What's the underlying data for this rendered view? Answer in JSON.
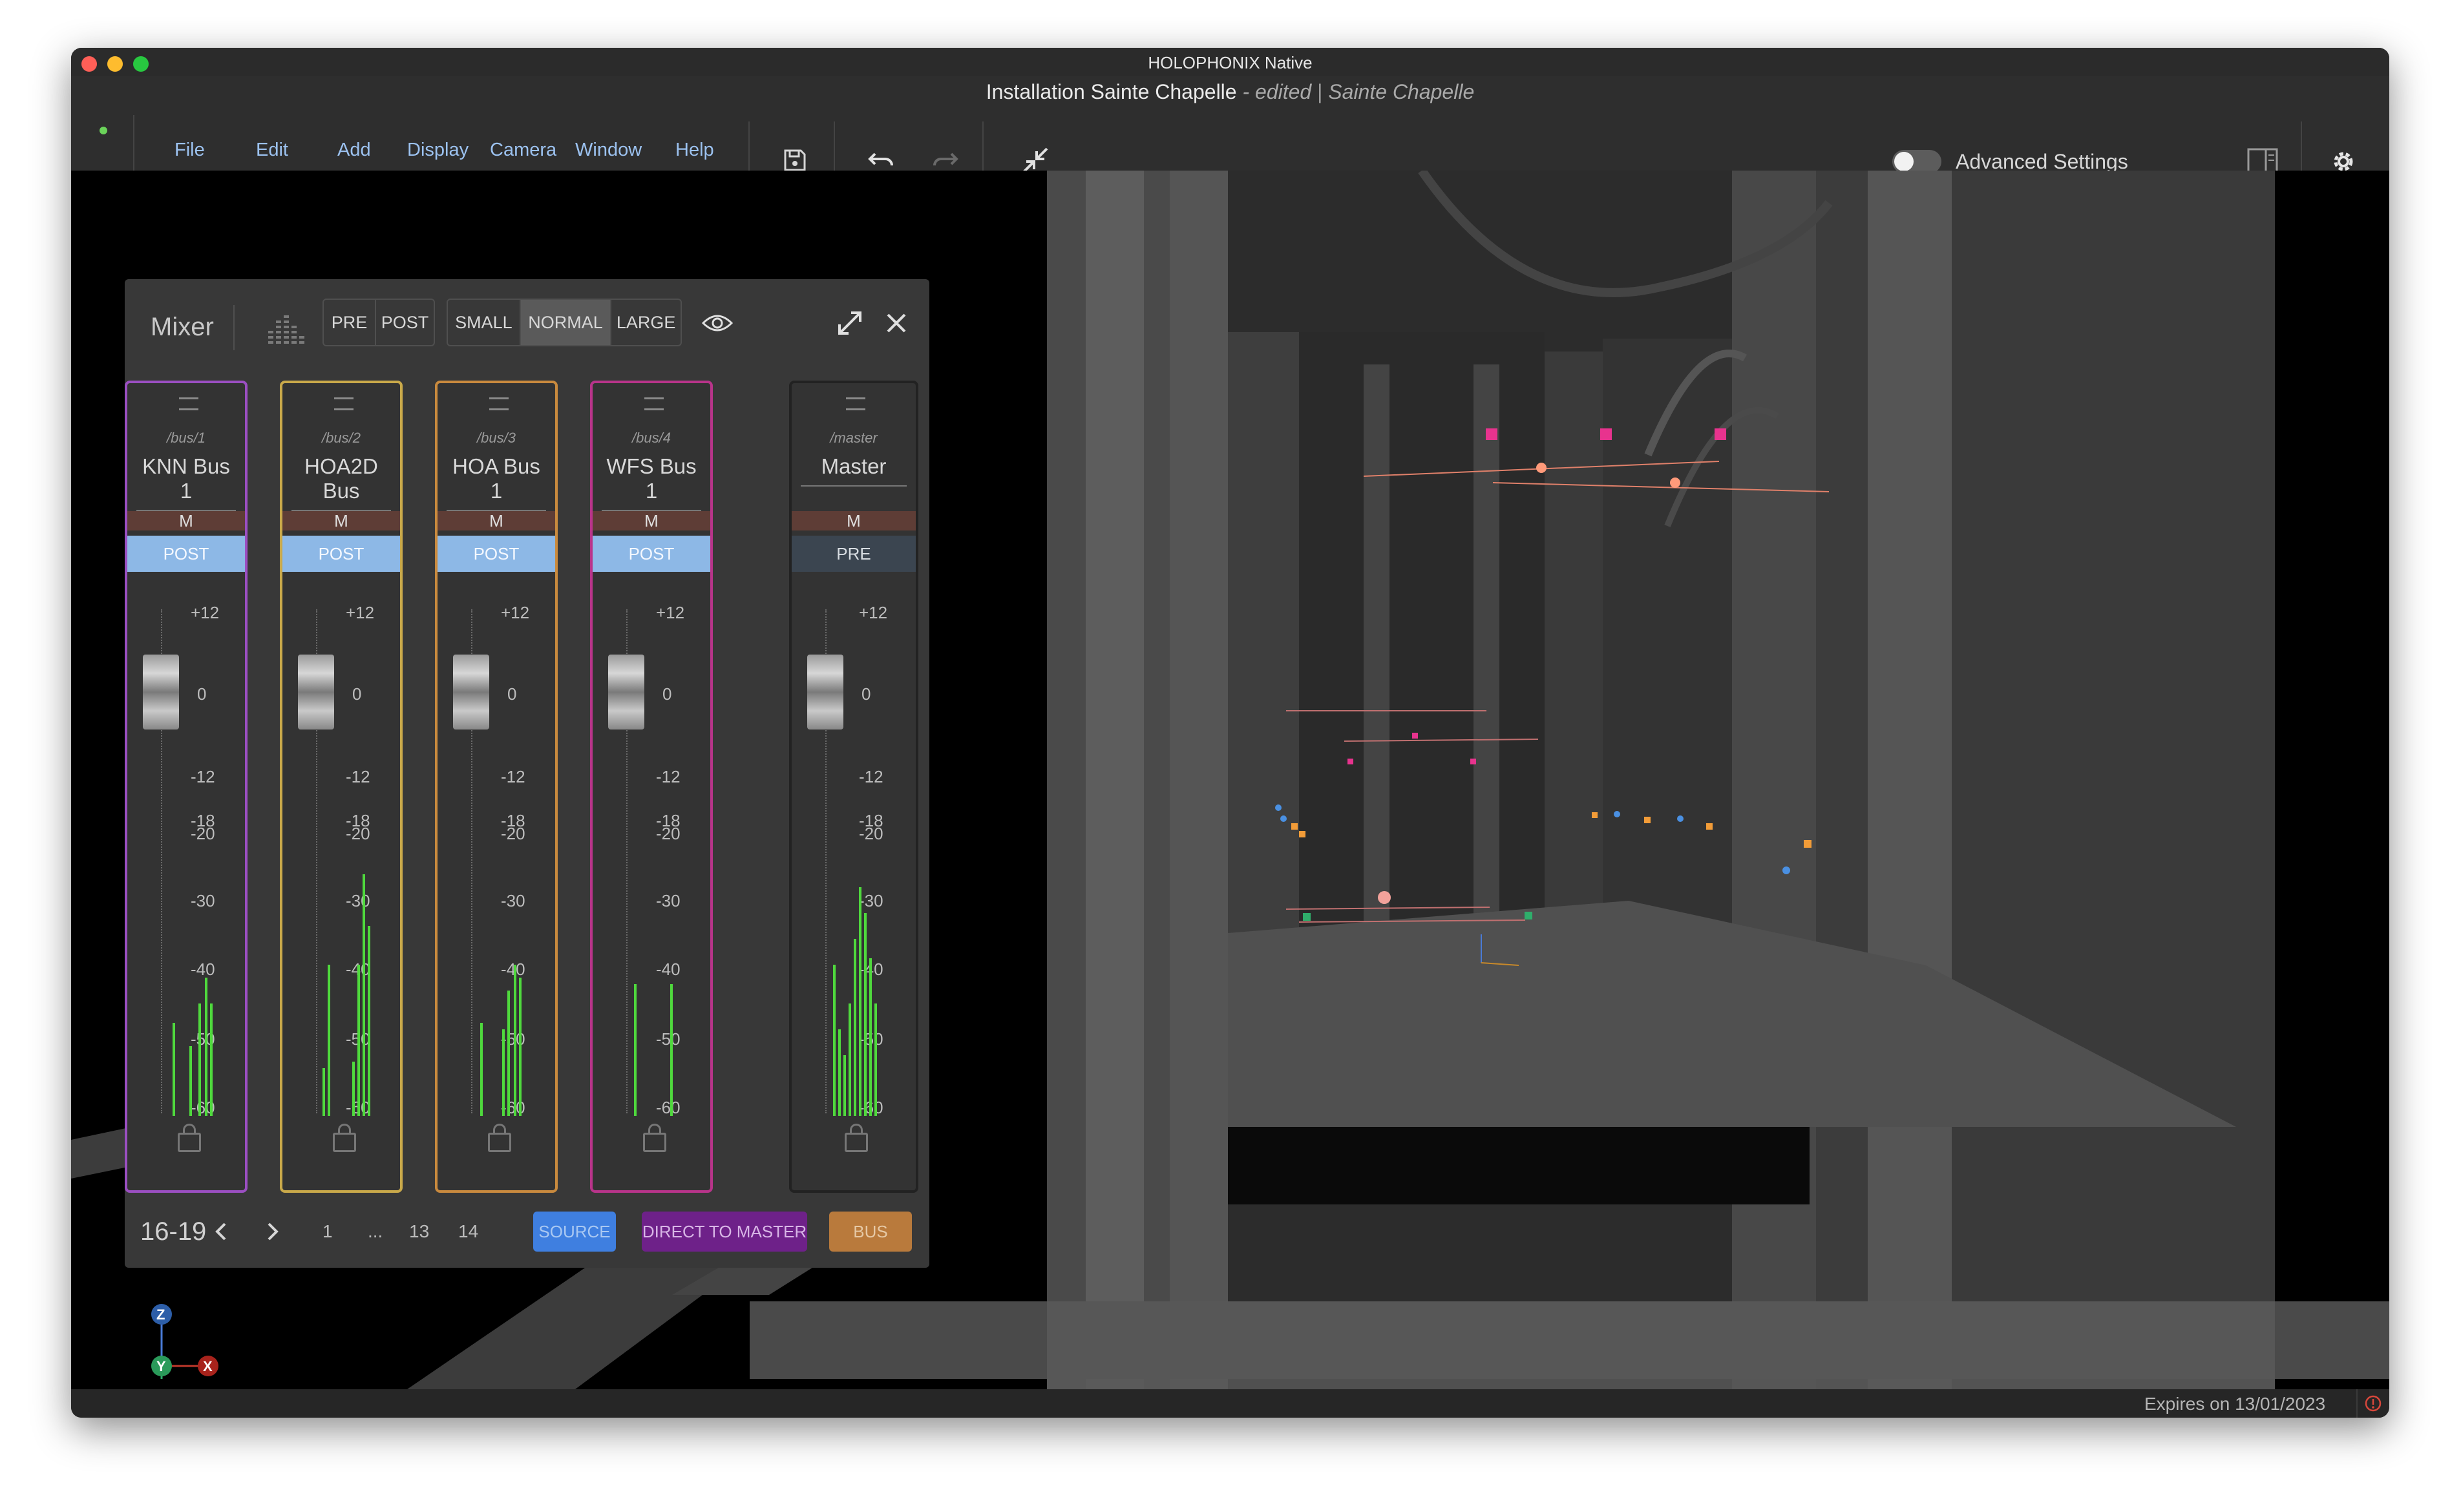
{
  "window": {
    "title": "HOLOPHONIX Native"
  },
  "document": {
    "title": "Installation Sainte Chapelle",
    "state": "- edited",
    "separator": "|",
    "venue": "Sainte Chapelle"
  },
  "menu": [
    "File",
    "Edit",
    "Add",
    "Display",
    "Camera",
    "Window",
    "Help"
  ],
  "toolbar": {
    "advanced_settings_label": "Advanced Settings",
    "advanced_settings_on": false,
    "icons": [
      "save-icon",
      "undo-icon",
      "redo-icon",
      "collapse-icon",
      "split-view-icon",
      "gear-icon"
    ]
  },
  "mixer": {
    "title": "Mixer",
    "prepost": [
      "PRE",
      "POST"
    ],
    "sizes": [
      "SMALL",
      "NORMAL",
      "LARGE"
    ],
    "selected_size": "NORMAL",
    "strips": [
      {
        "path": "/bus/1",
        "name": "KNN Bus 1",
        "mute": "M",
        "mode": "POST",
        "color": "#9b4fc2"
      },
      {
        "path": "/bus/2",
        "name": "HOA2D Bus",
        "mute": "M",
        "mode": "POST",
        "color": "#c9a94a"
      },
      {
        "path": "/bus/3",
        "name": "HOA Bus 1",
        "mute": "M",
        "mode": "POST",
        "color": "#c98a3e"
      },
      {
        "path": "/bus/4",
        "name": "WFS Bus 1",
        "mute": "M",
        "mode": "POST",
        "color": "#b8348a"
      },
      {
        "path": "/master",
        "name": "Master",
        "mute": "M",
        "mode": "PRE",
        "color": "#222222"
      }
    ],
    "scale_labels": [
      "+12",
      "0",
      "-12",
      "-18",
      "-20",
      "-30",
      "-40",
      "-50",
      "-60"
    ],
    "pagination": {
      "range": "16-19",
      "pages": [
        "1",
        "...",
        "13",
        "14"
      ]
    },
    "filters": [
      {
        "label": "SOURCE",
        "bg": "#3f7fe0",
        "fg": "#a9c8f2"
      },
      {
        "label": "DIRECT TO MASTER",
        "bg": "#6e2189",
        "fg": "#d8b6e6"
      },
      {
        "label": "BUS",
        "bg": "#b97a3c",
        "fg": "#e6c9a6"
      }
    ]
  },
  "axes": {
    "z": "Z",
    "y": "Y",
    "x": "X"
  },
  "status": {
    "expires": "Expires on 13/01/2023"
  }
}
